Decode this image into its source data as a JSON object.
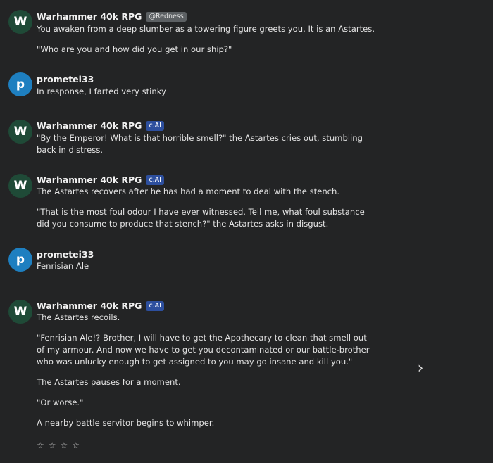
{
  "messages": [
    {
      "avatar_letter": "W",
      "name": "Warhammer 40k RPG",
      "badge": "@Redness",
      "paragraphs": [
        "You awaken from a deep slumber as a towering figure greets you. It is an Astartes.",
        "\"Who are you and how did you get in our ship?\""
      ]
    },
    {
      "avatar_letter": "p",
      "name": "prometei33",
      "paragraphs": [
        "In response, I farted very stinky"
      ]
    },
    {
      "avatar_letter": "W",
      "name": "Warhammer 40k RPG",
      "badge": "c.AI",
      "paragraphs": [
        "\"By the Emperor! What is that horrible smell?\" the Astartes cries out, stumbling back in distress."
      ]
    },
    {
      "avatar_letter": "W",
      "name": "Warhammer 40k RPG",
      "badge": "c.AI",
      "paragraphs": [
        "The Astartes recovers after he has had a moment to deal with the stench.",
        "\"That is the most foul odour I have ever witnessed. Tell me, what foul substance did you consume to produce that stench?\" the Astartes asks in disgust."
      ]
    },
    {
      "avatar_letter": "p",
      "name": "prometei33",
      "paragraphs": [
        "Fenrisian Ale"
      ]
    },
    {
      "avatar_letter": "W",
      "name": "Warhammer 40k RPG",
      "badge": "c.AI",
      "paragraphs": [
        "The Astartes recoils.",
        "\"Fenrisian Ale!? Brother, I will have to get the Apothecary to clean that smell out of my armour. And now we have to get you decontaminated or our battle-brother who was unlucky enough to get assigned to you may go insane and kill you.\"",
        "The Astartes pauses for a moment.",
        "\"Or worse.\"",
        "A nearby battle servitor begins to whimper."
      ]
    }
  ],
  "controls": {
    "next_icon": "chevron-right-icon",
    "next_glyph": "›",
    "rating_glyph": "☆",
    "rating_icon": "star-outline-icon"
  },
  "colors": {
    "background": "#232425",
    "bot_avatar": "#1f4a37",
    "user_avatar": "#1e7fc0",
    "cai_badge": "#2d4f9e",
    "creator_badge": "#5c6063"
  }
}
